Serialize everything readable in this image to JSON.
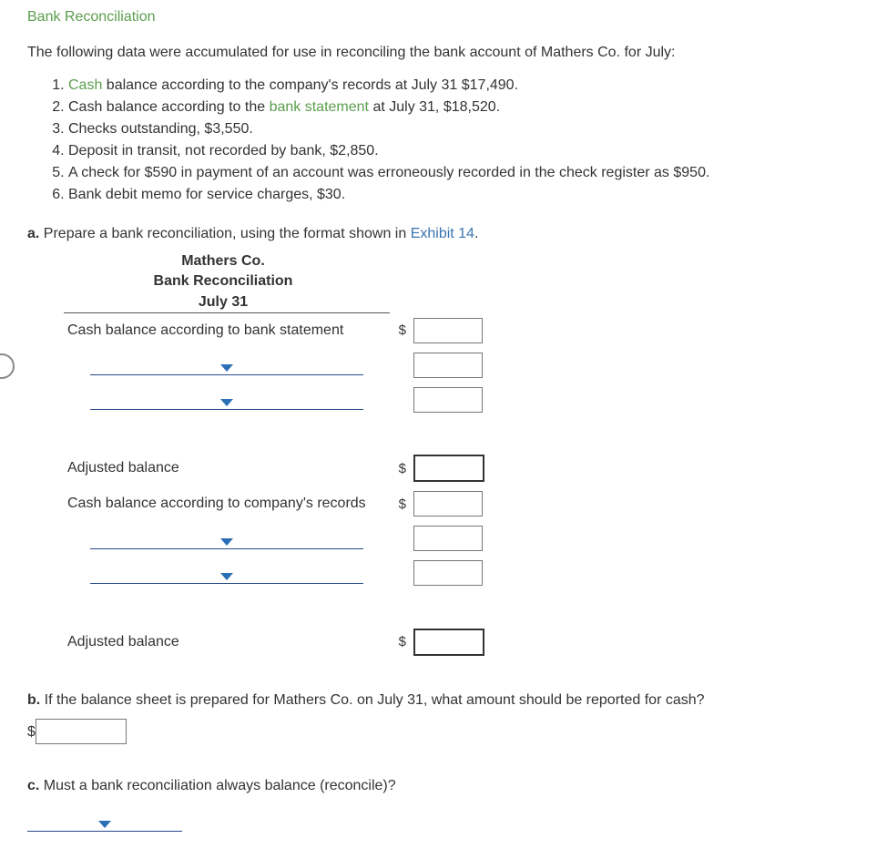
{
  "title": "Bank Reconciliation",
  "intro": "The following data were accumulated for use in reconciling the bank account of Mathers Co. for July:",
  "facts": {
    "f1_pre": "",
    "f1_link": "Cash",
    "f1_post": " balance according to the company's records at July 31 $17,490.",
    "f2_pre": "Cash balance according to the ",
    "f2_link": "bank statement",
    "f2_post": " at July 31, $18,520.",
    "f3": "Checks outstanding, $3,550.",
    "f4": "Deposit in transit, not recorded by bank, $2,850.",
    "f5": "A check for $590 in payment of an account was erroneously recorded in the check register as $950.",
    "f6": "Bank debit memo for service charges, $30."
  },
  "partA": {
    "label": "a.",
    "text_pre": "  Prepare a bank reconciliation, using the format shown in ",
    "link": "Exhibit 14",
    "text_post": ".",
    "header_company": "Mathers Co.",
    "header_title": "Bank Reconciliation",
    "header_date": "July 31",
    "row_bank_stmt": "Cash balance according to bank statement",
    "row_adj_balance": "Adjusted balance",
    "row_company": "Cash balance according to company's records",
    "dollar": "$"
  },
  "partB": {
    "label": "b.",
    "text": "  If the balance sheet is prepared for Mathers Co. on July 31, what amount should be reported for cash?",
    "dollar": "$"
  },
  "partC": {
    "label": "c.",
    "text": "  Must a bank reconciliation always balance (reconcile)?"
  }
}
